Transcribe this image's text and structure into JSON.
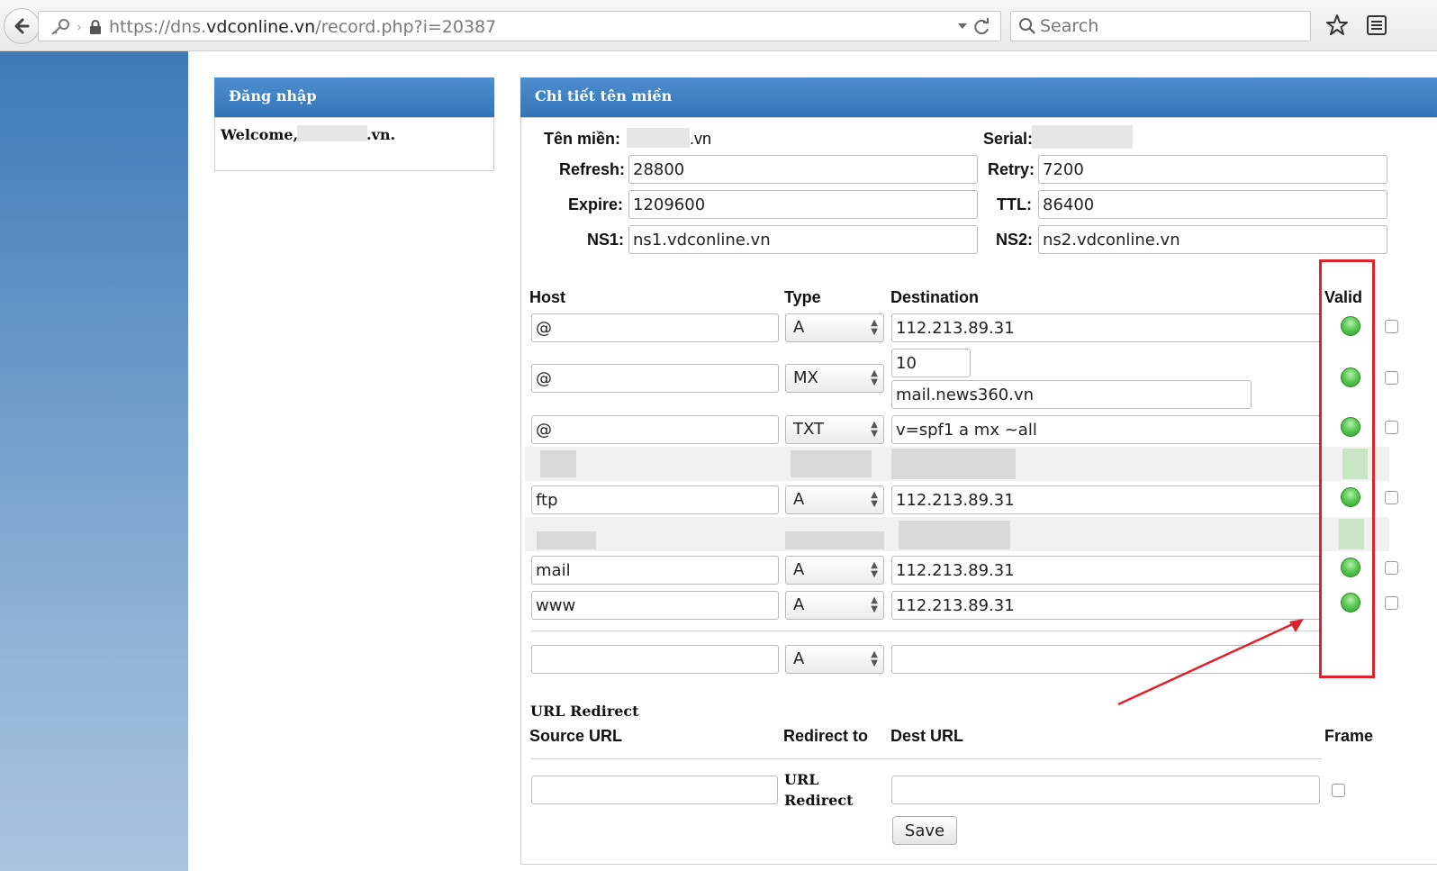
{
  "browser": {
    "url_scheme": "https://",
    "url_host_prefix": "dns.",
    "url_host_domain": "vdconline.vn",
    "url_path": "/record.php?i=20387",
    "search_placeholder": "Search"
  },
  "login_panel": {
    "title": "Đăng nhập",
    "welcome_prefix": "Welcome,",
    "welcome_suffix": ".vn."
  },
  "detail_panel": {
    "title": "Chi tiết tên miền",
    "domain_label": "Tên miền:",
    "domain_suffix": ".vn",
    "serial_label": "Serial:",
    "refresh_label": "Refresh:",
    "refresh_value": "28800",
    "retry_label": "Retry:",
    "retry_value": "7200",
    "expire_label": "Expire:",
    "expire_value": "1209600",
    "ttl_label": "TTL:",
    "ttl_value": "86400",
    "ns1_label": "NS1:",
    "ns1_value": "ns1.vdconline.vn",
    "ns2_label": "NS2:",
    "ns2_value": "ns2.vdconline.vn"
  },
  "records": {
    "headers": {
      "host": "Host",
      "type": "Type",
      "destination": "Destination",
      "valid": "Valid"
    },
    "rows": [
      {
        "host": "@",
        "type": "A",
        "destination": "112.213.89.31"
      },
      {
        "host": "@",
        "type": "MX",
        "priority": "10",
        "destination": "mail.news360.vn"
      },
      {
        "host": "@",
        "type": "TXT",
        "destination": "v=spf1 a mx ~all"
      },
      {
        "host": "ftp",
        "type": "A",
        "destination": "112.213.89.31"
      },
      {
        "host": "mail",
        "type": "A",
        "destination": "112.213.89.31"
      },
      {
        "host": "www",
        "type": "A",
        "destination": "112.213.89.31"
      },
      {
        "host": "",
        "type": "A",
        "destination": ""
      }
    ]
  },
  "url_redirect": {
    "title": "URL Redirect",
    "source_header": "Source URL",
    "redirect_header": "Redirect to",
    "dest_header": "Dest URL",
    "frame_header": "Frame",
    "redirect_type_line1": "URL",
    "redirect_type_line2": "Redirect",
    "save_label": "Save"
  },
  "colors": {
    "panel_header": "#3a7fc4",
    "annotation": "#e0222a",
    "valid_green": "#4cbf45"
  }
}
